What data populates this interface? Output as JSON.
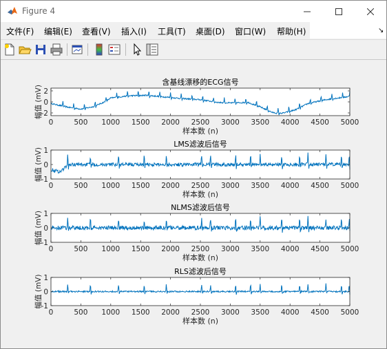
{
  "window": {
    "title": "Figure 4"
  },
  "menu": [
    "文件(F)",
    "编辑(E)",
    "查看(V)",
    "插入(I)",
    "工具(T)",
    "桌面(D)",
    "窗口(W)",
    "帮助(H)"
  ],
  "menu_overflow_icon": "overflow-arrow-icon",
  "toolbar_icons": [
    "new-figure-icon",
    "open-file-icon",
    "save-icon",
    "print-icon",
    "link-plot-icon",
    "colorbar-icon",
    "legend-icon",
    "pointer-icon",
    "property-inspector-icon"
  ],
  "chart_data": [
    {
      "type": "line",
      "title": "含基线漂移的ECG信号",
      "xlabel": "样本数 (n)",
      "ylabel": "幅值 (mV)",
      "xlim": [
        0,
        5000
      ],
      "ylim": [
        -2.5,
        2.5
      ],
      "xticks": [
        0,
        500,
        1000,
        1500,
        2000,
        2500,
        3000,
        3500,
        4000,
        4500,
        5000
      ],
      "yticks": [
        -2,
        0,
        2
      ],
      "color": "#0072BD",
      "baseline": {
        "x": [
          0,
          300,
          500,
          700,
          900,
          1000,
          1300,
          1600,
          1900,
          2200,
          2500,
          2800,
          3000,
          3300,
          3500,
          3700,
          3800,
          3900,
          4100,
          4300,
          4600,
          5000
        ],
        "y": [
          -0.3,
          -1.0,
          -1.3,
          -0.9,
          0.0,
          0.7,
          1.1,
          1.2,
          0.9,
          0.6,
          0.4,
          -0.1,
          -0.2,
          -0.1,
          -0.9,
          -1.9,
          -2.1,
          -2.0,
          -1.4,
          -0.3,
          0.4,
          1.0
        ]
      },
      "r_peaks_x": [
        200,
        380,
        560,
        740,
        920,
        1100,
        1280,
        1460,
        1640,
        1820,
        2000,
        2180,
        2360,
        2540,
        2720,
        2900,
        3080,
        3260,
        3440,
        3620,
        3800,
        3980,
        4160,
        4340,
        4520,
        4700,
        4880,
        5000
      ],
      "spike_height": 0.9,
      "noise_amplitude": 0.12
    },
    {
      "type": "line",
      "title": "LMS滤波后信号",
      "xlabel": "样本数 (n)",
      "ylabel": "幅值 (mV)",
      "xlim": [
        0,
        5000
      ],
      "ylim": [
        -1,
        1
      ],
      "xticks": [
        0,
        500,
        1000,
        1500,
        2000,
        2500,
        3000,
        3500,
        4000,
        4500,
        5000
      ],
      "yticks": [
        -1,
        0,
        1
      ],
      "color": "#0072BD",
      "baseline": {
        "x": [
          0,
          150,
          300,
          5000
        ],
        "y": [
          -0.35,
          -0.5,
          0.0,
          0.0
        ]
      },
      "r_peaks_x": [
        280,
        660,
        1130,
        1560,
        1930,
        2520,
        2670,
        3090,
        3340,
        3500,
        3860,
        4160,
        4300,
        4600,
        4860,
        4990
      ],
      "spike_height": 0.75,
      "noise_amplitude": 0.12
    },
    {
      "type": "line",
      "title": "NLMS滤波后信号",
      "xlabel": "样本数 (n)",
      "ylabel": "幅值 (mV)",
      "xlim": [
        0,
        5000
      ],
      "ylim": [
        -1,
        1
      ],
      "xticks": [
        0,
        500,
        1000,
        1500,
        2000,
        2500,
        3000,
        3500,
        4000,
        4500,
        5000
      ],
      "yticks": [
        -1,
        0,
        1
      ],
      "color": "#0072BD",
      "baseline": {
        "x": [
          0,
          5000
        ],
        "y": [
          0.0,
          0.0
        ]
      },
      "r_peaks_x": [
        280,
        660,
        1130,
        1560,
        1930,
        2520,
        2670,
        3090,
        3340,
        3500,
        3860,
        4160,
        4300,
        4600,
        4860,
        4990
      ],
      "spike_height": 0.7,
      "noise_amplitude": 0.14
    },
    {
      "type": "line",
      "title": "RLS滤波后信号",
      "xlabel": "样本数 (n)",
      "ylabel": "幅值 (mV)",
      "xlim": [
        0,
        5000
      ],
      "ylim": [
        -1,
        1
      ],
      "xticks": [
        0,
        500,
        1000,
        1500,
        2000,
        2500,
        3000,
        3500,
        4000,
        4500,
        5000
      ],
      "yticks": [
        -1,
        0,
        1
      ],
      "color": "#0072BD",
      "baseline": {
        "x": [
          0,
          5000
        ],
        "y": [
          0.0,
          0.0
        ]
      },
      "r_peaks_x": [
        280,
        660,
        1130,
        1560,
        1930,
        2520,
        2670,
        3090,
        3340,
        3500,
        3860,
        4160,
        4300,
        4600,
        4860,
        4990
      ],
      "spike_height": 0.55,
      "noise_amplitude": 0.05
    }
  ]
}
